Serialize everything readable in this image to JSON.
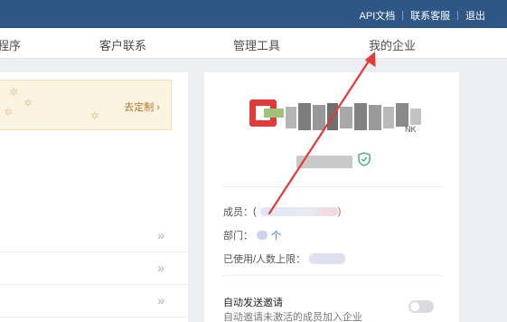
{
  "topbar": {
    "links": [
      "API文档",
      "联系客服",
      "退出"
    ]
  },
  "nav": {
    "items": [
      "程序",
      "客户联系",
      "管理工具",
      "我的企业"
    ]
  },
  "left_panel": {
    "banner_cta": "去定制 ›",
    "row_chevron": "»"
  },
  "company": {
    "name_suffix": "NK",
    "member_label": "成员：",
    "member_value_prefix": "(",
    "member_value_suffix": ")",
    "department_label": "部门：",
    "department_unit": "个",
    "usage_label": "已使用/人数上限：",
    "auto_invite_title": "自动发送邀请",
    "auto_invite_desc": "自动邀请未激活的成员加入企业"
  },
  "colors": {
    "topbar": "#2f5785",
    "accent": "#2d78d8",
    "annotation": "#e53935"
  }
}
